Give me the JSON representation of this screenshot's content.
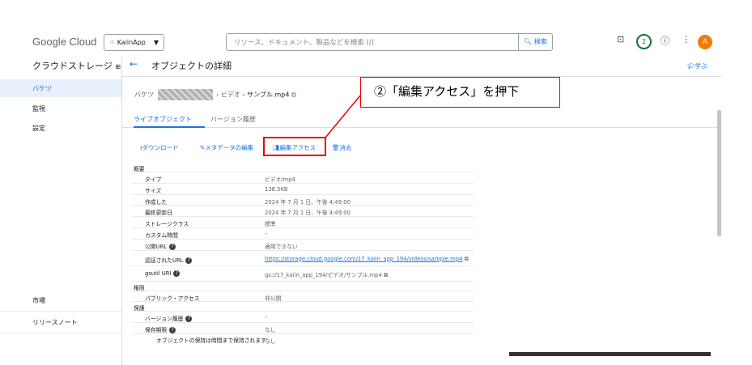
{
  "topbar": {
    "logo": "Google Cloud",
    "project": "KaiinApp",
    "search_placeholder": "リソース、ドキュメント、製品などを検索 (/)",
    "search_button": "検索",
    "badge_count": "2",
    "avatar_letter": "A"
  },
  "sidebar": {
    "title": "クラウドストレージ",
    "items": [
      "バケツ",
      "監視",
      "設定"
    ],
    "bottom_items": [
      "市場",
      "リリースノート"
    ]
  },
  "header": {
    "title": "オブジェクトの詳細",
    "learn": "学ぶ",
    "breadcrumb": [
      "バケツ",
      "ビデオ",
      "サンプル.mp4"
    ]
  },
  "tabs": [
    "ライブオブジェクト",
    "バージョン履歴"
  ],
  "actions": {
    "download": "ダウンロード",
    "edit_metadata": "メタデータの編集",
    "edit_access": "編集アクセス",
    "delete": "消去"
  },
  "details": {
    "section_overview": "概要",
    "overview": [
      {
        "k": "タイプ",
        "v": "ビデオ/mp4"
      },
      {
        "k": "サイズ",
        "v": "138.5KB"
      },
      {
        "k": "作成した",
        "v": "2024 年 7 月 1 日、午後 4:49:00"
      },
      {
        "k": "最終更新日",
        "v": "2024 年 7 月 1 日、午後 4:49:00"
      },
      {
        "k": "ストレージクラス",
        "v": "標準"
      },
      {
        "k": "カスタム時間",
        "v": "–"
      },
      {
        "k": "公開URL",
        "v": "適用できない"
      },
      {
        "k": "認証されたURL",
        "v": "https://storage.cloud.google.com/17_kaiin_app_194/videos/sample.mp4"
      },
      {
        "k": "gsutil URI",
        "v": "gs://17_kaiin_app_194/ビデオ/サンプル.mp4"
      }
    ],
    "section_permissions": "権限",
    "public_access": {
      "k": "パブリック・アクセス",
      "v": "非公開"
    },
    "section_protection": "保護",
    "version_history": {
      "k": "バージョン履歴",
      "v": "–"
    },
    "retention": {
      "k": "保存期限",
      "v": "なし"
    },
    "hold": {
      "k": "オブジェクトの保持は時間まで保持されます",
      "v": "なし"
    }
  },
  "annotation": {
    "text": "②「編集アクセス」を押下",
    "color": "#ee0000"
  }
}
